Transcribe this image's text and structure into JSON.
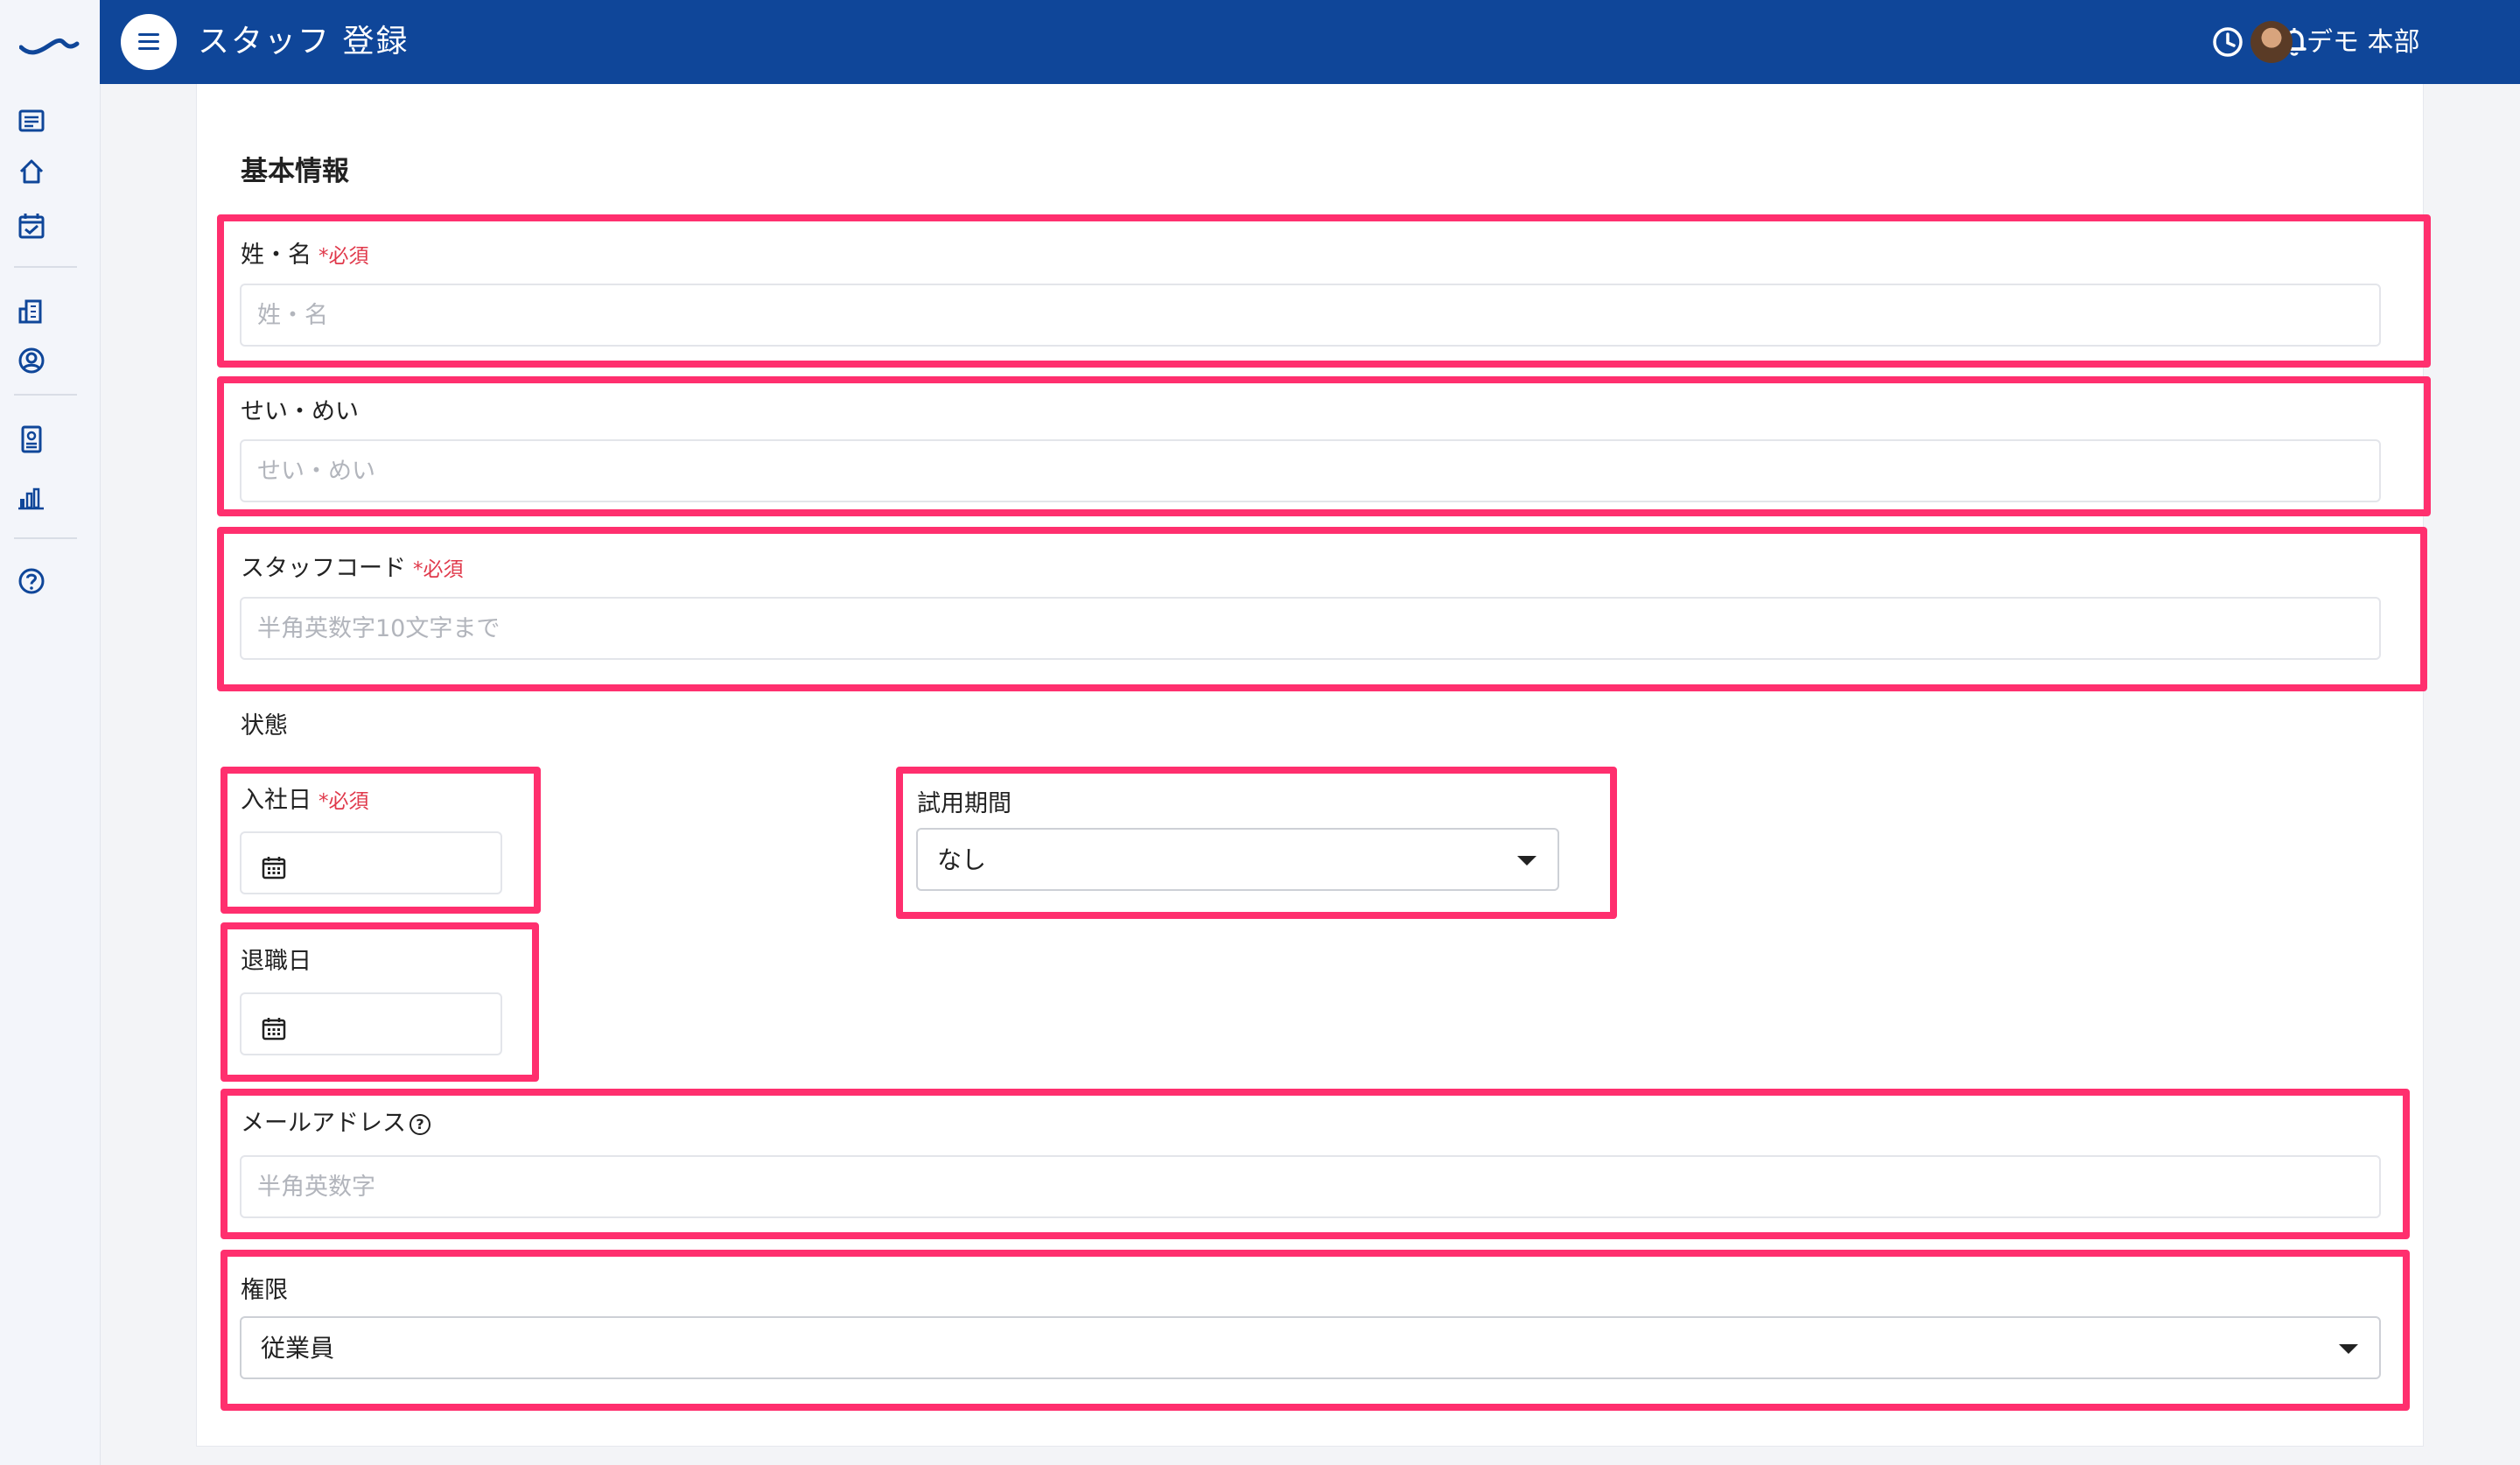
{
  "header": {
    "title": "スタッフ 登録",
    "user_name": "デモ 本部"
  },
  "sidebar": {
    "icons": [
      "list-icon",
      "home-icon",
      "calendar-check-icon",
      "building-icon",
      "user-circle-icon",
      "id-badge-icon",
      "bar-chart-icon",
      "help-icon"
    ]
  },
  "form": {
    "section_title": "基本情報",
    "required_mark": "*必須",
    "name": {
      "label": "姓・名",
      "placeholder": "姓・名"
    },
    "kana": {
      "label": "せい・めい",
      "placeholder": "せい・めい"
    },
    "staff_code": {
      "label": "スタッフコード",
      "placeholder": "半角英数字10文字まで"
    },
    "status_label": "状態",
    "hire_date": {
      "label": "入社日"
    },
    "trial_period": {
      "label": "試用期間",
      "value": "なし"
    },
    "retire_date": {
      "label": "退職日"
    },
    "email": {
      "label": "メールアドレス",
      "placeholder": "半角英数字"
    },
    "role": {
      "label": "権限",
      "value": "従業員"
    }
  },
  "colors": {
    "header_bg": "#0f4699",
    "highlight": "#ff2f6e",
    "required": "#e0394b"
  }
}
